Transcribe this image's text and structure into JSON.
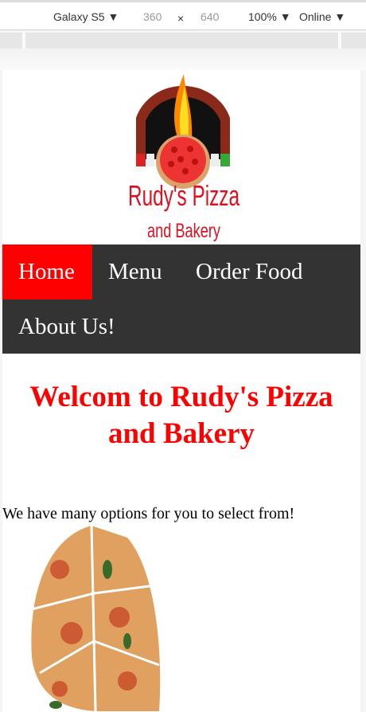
{
  "toolbar": {
    "device": "Galaxy S5 ▼",
    "width": "360",
    "times": "×",
    "height": "640",
    "zoom": "100% ▼",
    "network": "Online ▼"
  },
  "logo": {
    "line1": "Rudy's Pizza",
    "line2": "and Bakery"
  },
  "nav": [
    {
      "label": "Home",
      "active": true
    },
    {
      "label": "Menu"
    },
    {
      "label": "Order Food"
    },
    {
      "label": "About Us!"
    }
  ],
  "main": {
    "heading": "Welcom to Rudy's Pizza and Bakery",
    "intro": "We have many options for you to select from!"
  },
  "colors": {
    "accent": "#ff0000",
    "nav_bg": "#333333"
  }
}
